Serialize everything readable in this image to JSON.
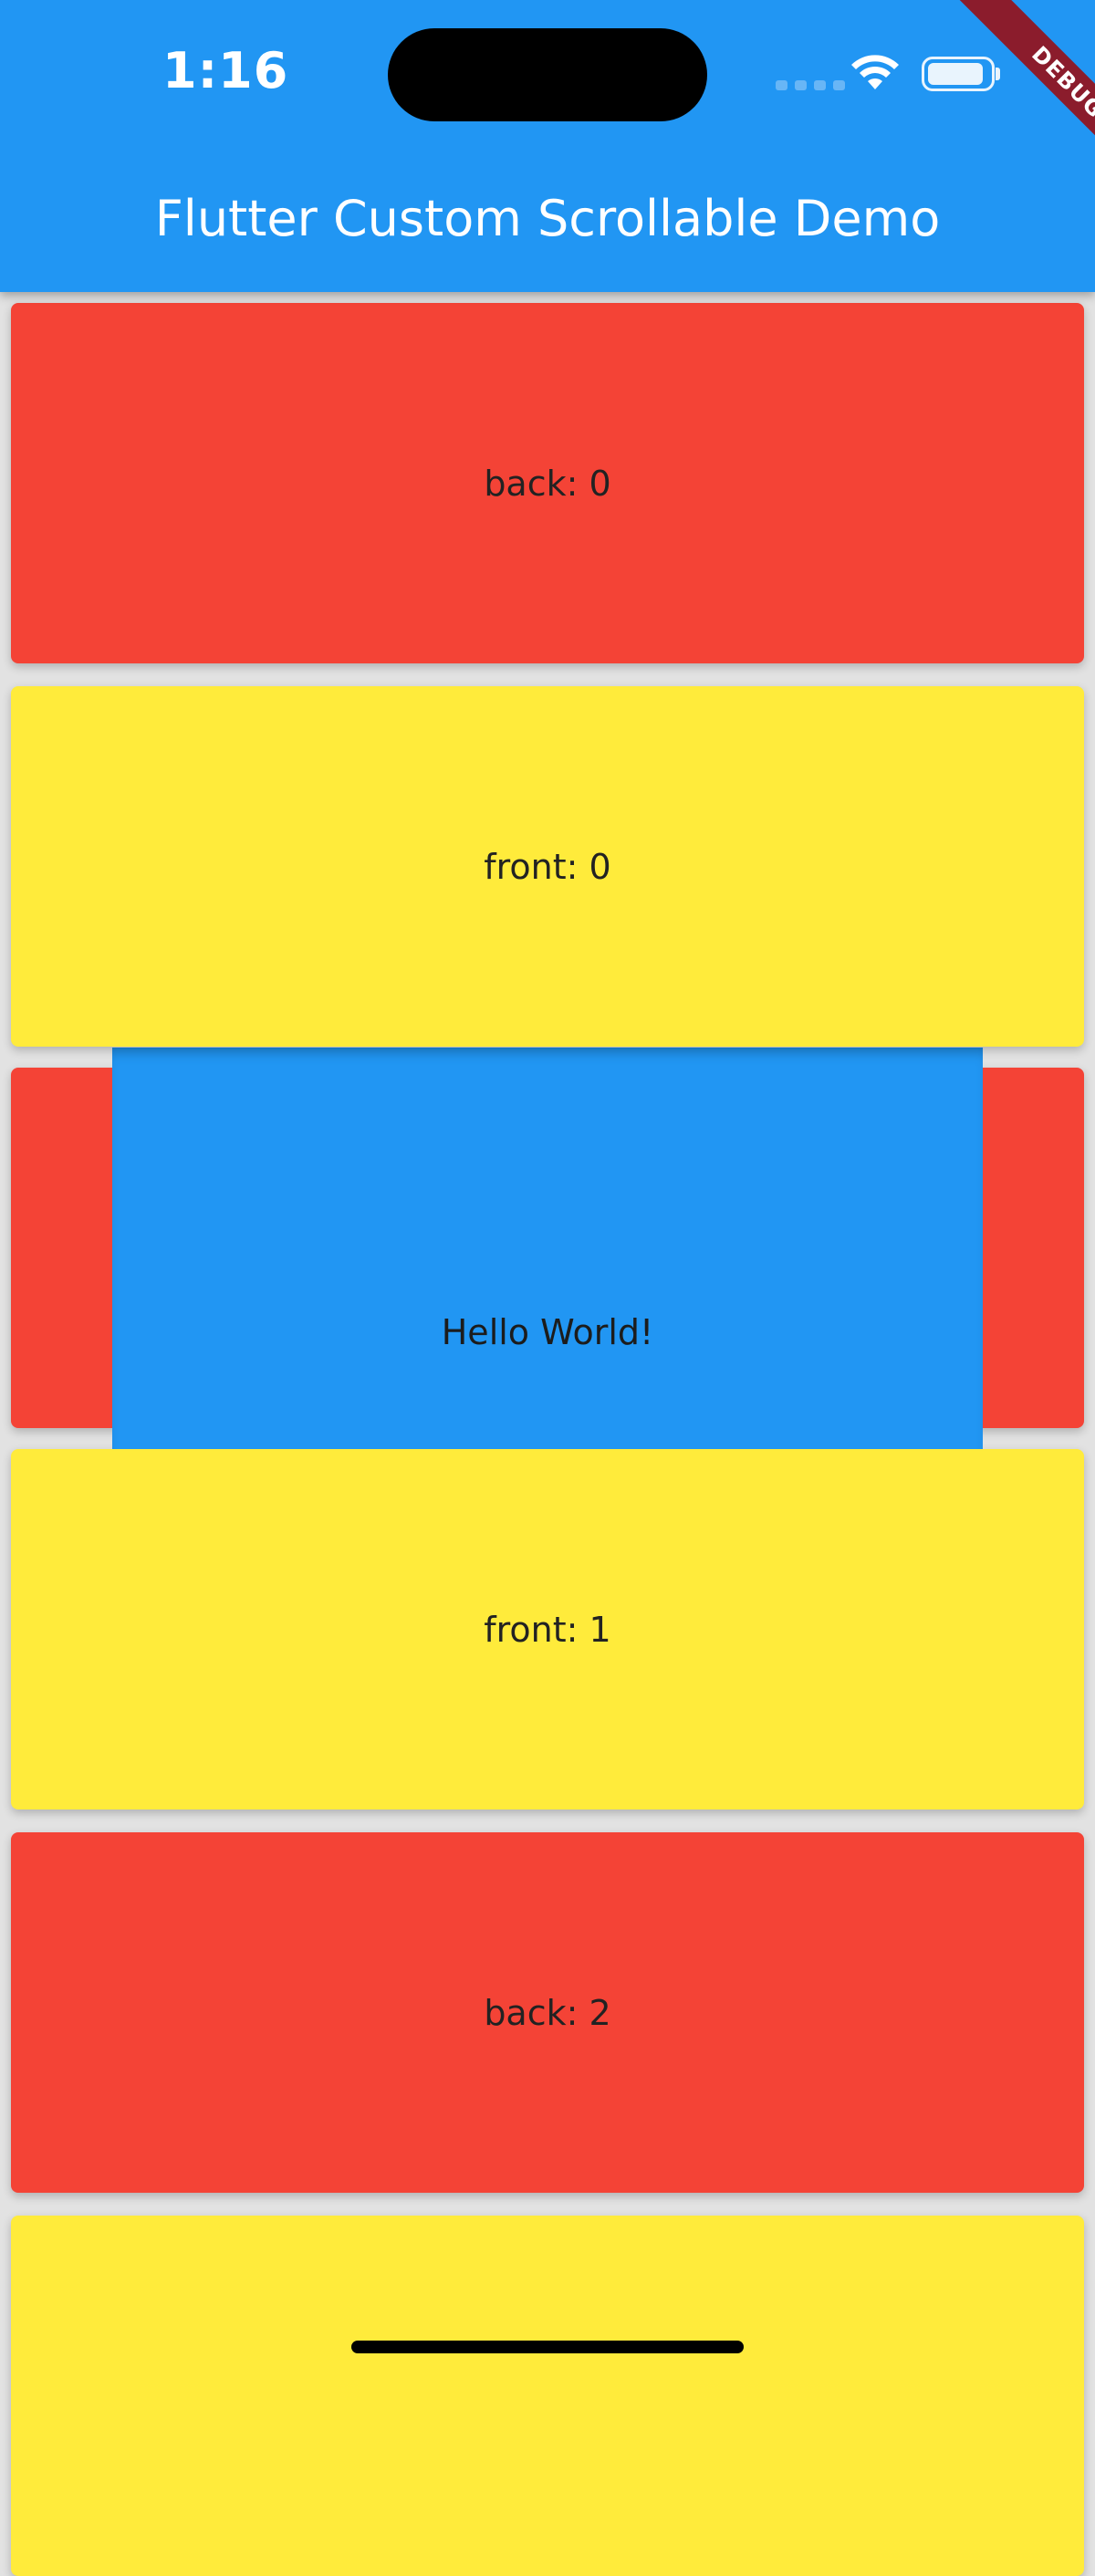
{
  "status_bar": {
    "time": "1:16",
    "debug_banner": "DEBUG"
  },
  "app_bar": {
    "title": "Flutter Custom Scrollable Demo",
    "color": "#2196f3"
  },
  "cards": [
    {
      "label": "back: 0",
      "color": "#f44336"
    },
    {
      "label": "front: 0",
      "color": "#ffeb3b"
    },
    {
      "label": "",
      "color": "#f44336"
    },
    {
      "label": "front: 1",
      "color": "#ffeb3b"
    },
    {
      "label": "back: 2",
      "color": "#f44336"
    },
    {
      "label": "",
      "color": "#ffeb3b"
    }
  ],
  "overlay": {
    "label": "Hello World!",
    "color": "#2196f3"
  }
}
